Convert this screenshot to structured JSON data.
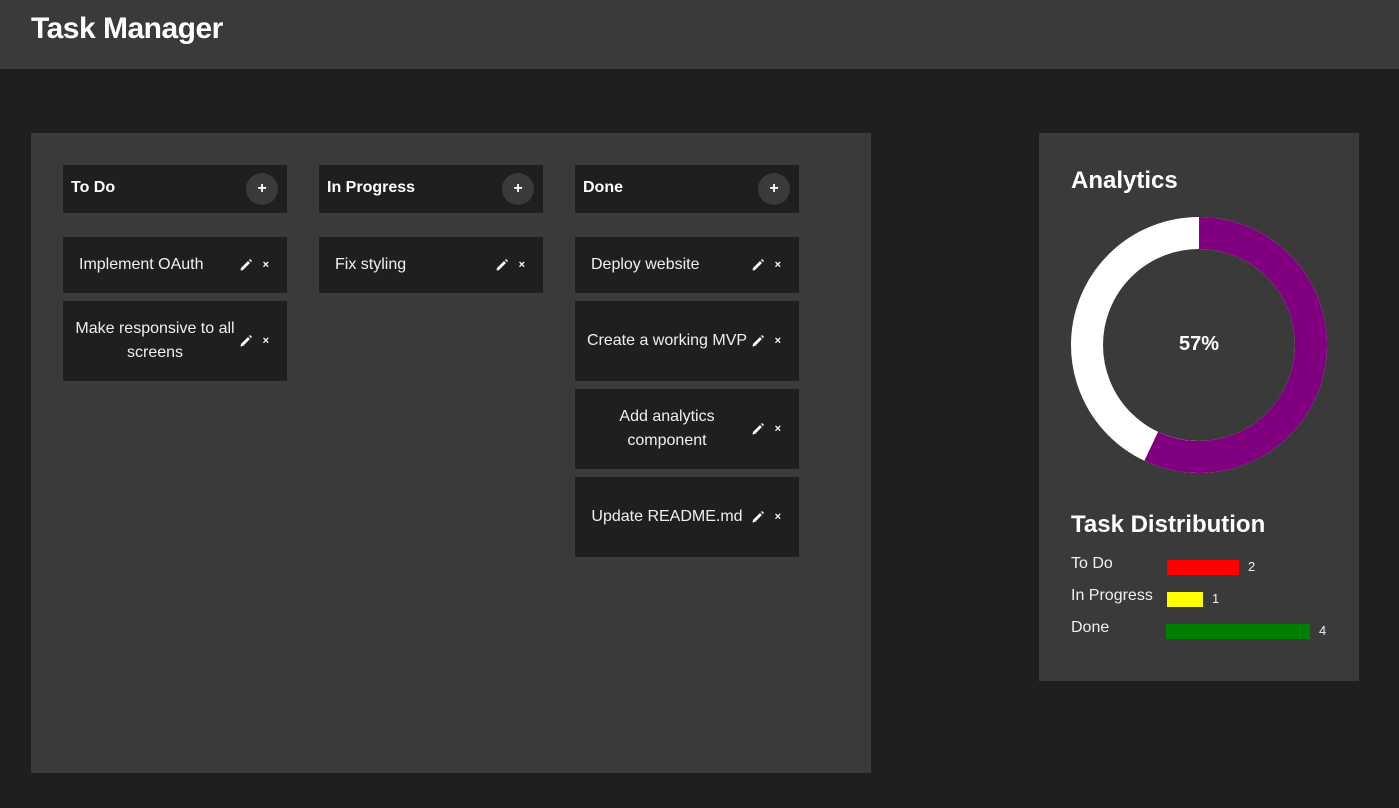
{
  "app": {
    "title": "Task Manager"
  },
  "board": {
    "columns": [
      {
        "title": "To Do",
        "add_label": "+",
        "cards": [
          "Implement OAuth",
          "Make responsive to all screens"
        ]
      },
      {
        "title": "In Progress",
        "add_label": "+",
        "cards": [
          "Fix styling"
        ]
      },
      {
        "title": "Done",
        "add_label": "+",
        "cards": [
          "Deploy website",
          "Create a working MVP",
          "Add analytics component",
          "Update README.md"
        ]
      }
    ],
    "edit_icon": "pencil-icon",
    "delete_label": "×"
  },
  "analytics": {
    "title": "Analytics",
    "completion_percent": 57,
    "completion_label": "57%",
    "donut_colors": {
      "done": "#800080",
      "remaining": "#ffffff"
    },
    "distribution_title": "Task Distribution",
    "distribution": [
      {
        "label": "To Do",
        "count": "2",
        "value": 2,
        "color": "#ff0000"
      },
      {
        "label": "In Progress",
        "count": "1",
        "value": 1,
        "color": "#ffff00"
      },
      {
        "label": "Done",
        "count": "4",
        "value": 4,
        "color": "#008000"
      }
    ]
  }
}
